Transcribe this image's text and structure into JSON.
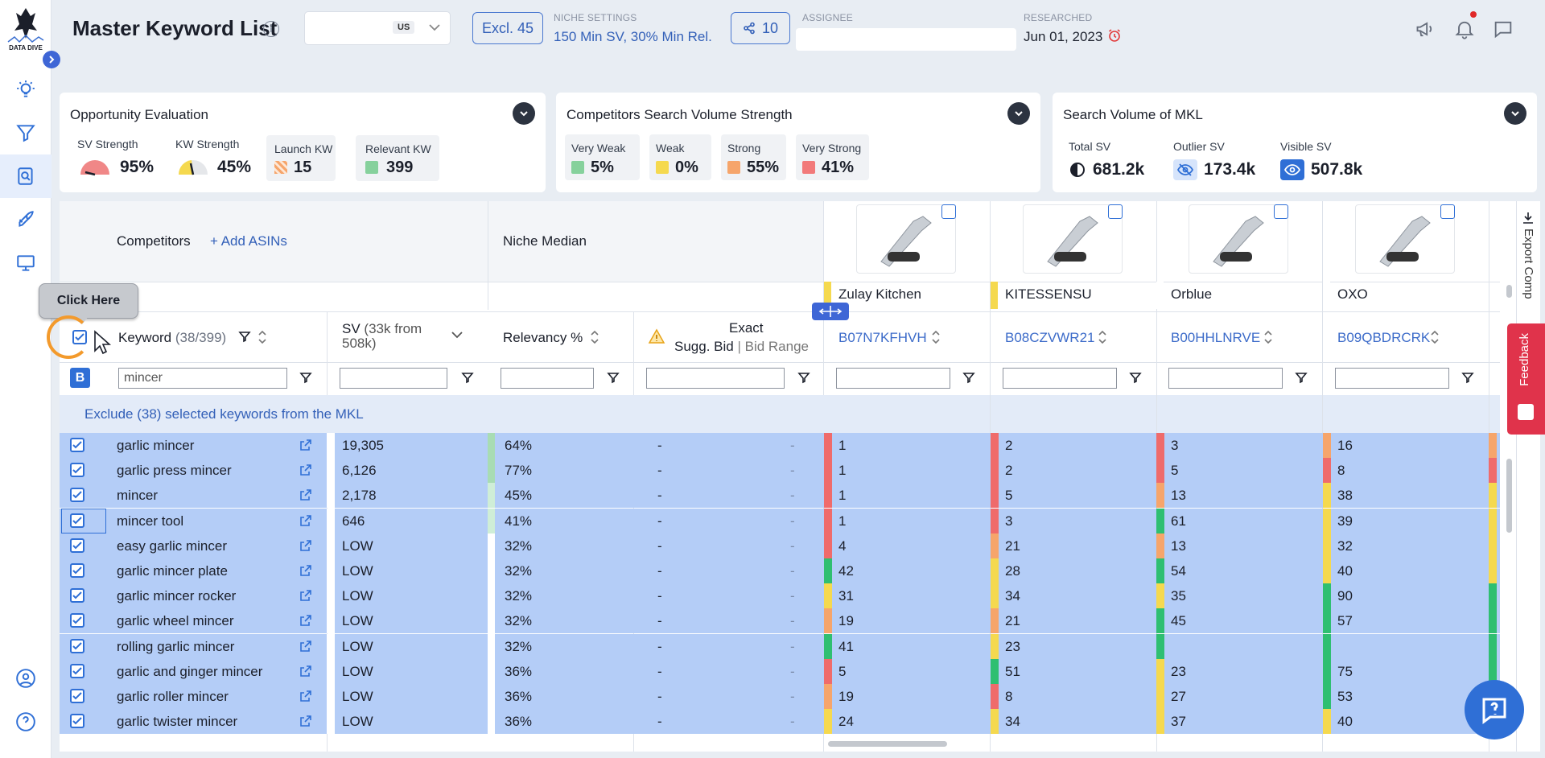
{
  "header": {
    "title": "Master Keyword List",
    "info": "i",
    "marketplace": "US",
    "excl_label": "Excl. 45",
    "niche_caption": "NICHE SETTINGS",
    "niche_value": "150 Min SV, 30% Min Rel.",
    "share_count": "10",
    "assignee_caption": "ASSIGNEE",
    "researched_caption": "RESEARCHED",
    "researched_date": "Jun 01, 2023"
  },
  "sidebar": {
    "logo_text": "DATA DIVE"
  },
  "opportunity": {
    "title": "Opportunity Evaluation",
    "sv_strength_label": "SV Strength",
    "sv_strength": "95%",
    "sv_strength_level": 0.95,
    "kw_strength_label": "KW Strength",
    "kw_strength": "45%",
    "kw_strength_level": 0.45,
    "launch_label": "Launch KW",
    "launch_value": "15",
    "relevant_label": "Relevant KW",
    "relevant_value": "399"
  },
  "competitors_strength": {
    "title": "Competitors Search Volume Strength",
    "items": [
      {
        "label": "Very Weak",
        "value": "5%",
        "color": "#86d19c"
      },
      {
        "label": "Weak",
        "value": "0%",
        "color": "#f5d94f"
      },
      {
        "label": "Strong",
        "value": "55%",
        "color": "#f6a56b"
      },
      {
        "label": "Very Strong",
        "value": "41%",
        "color": "#f27a7a"
      }
    ]
  },
  "search_volume": {
    "title": "Search Volume of MKL",
    "total_label": "Total SV",
    "total": "681.2k",
    "outlier_label": "Outlier SV",
    "outlier": "173.4k",
    "visible_label": "Visible SV",
    "visible": "507.8k"
  },
  "table": {
    "competitors_label": "Competitors",
    "add_asins": "+ Add ASINs",
    "niche_median": "Niche Median",
    "brand_row_label": "nd",
    "keyword_header": "Keyword",
    "keyword_count": "(38/399)",
    "sv_header": "SV",
    "sv_sub": "(33k from 508k)",
    "relevancy_header": "Relevancy %",
    "exact_header": "Exact",
    "sugg_bid": "Sugg. Bid",
    "bid_range": "Bid Range",
    "keyword_filter": "mincer",
    "b_badge": "B",
    "exclude_banner": "Exclude (38) selected keywords from the MKL",
    "competitors": [
      {
        "brand": "Zulay Kitchen",
        "asin": "B07N7KFHVH",
        "color": "#f5d94f"
      },
      {
        "brand": "KITESSENSU",
        "asin": "B08CZVWR21",
        "color": "#f5d94f"
      },
      {
        "brand": "Orblue",
        "asin": "B00HHLNRVE",
        "color": "#ffffff"
      },
      {
        "brand": "OXO",
        "asin": "B09QBDRCRK",
        "color": "#ffffff"
      }
    ],
    "rows": [
      {
        "kw": "garlic mincer",
        "sv": "19,305",
        "rel": "64%",
        "bid": "-",
        "range": "-",
        "r": [
          "1",
          "2",
          "3",
          "16"
        ],
        "c": [
          "#ef6b6b",
          "#ef6b6b",
          "#ef6b6b",
          "#f6a56b"
        ],
        "relc": "#a8dcb4"
      },
      {
        "kw": "garlic press mincer",
        "sv": "6,126",
        "rel": "77%",
        "bid": "-",
        "range": "-",
        "r": [
          "1",
          "2",
          "5",
          "8"
        ],
        "c": [
          "#ef6b6b",
          "#ef6b6b",
          "#ef6b6b",
          "#ef6b6b"
        ],
        "relc": "#a8dcb4"
      },
      {
        "kw": "mincer",
        "sv": "2,178",
        "rel": "45%",
        "bid": "-",
        "range": "-",
        "r": [
          "1",
          "5",
          "13",
          "38"
        ],
        "c": [
          "#ef6b6b",
          "#ef6b6b",
          "#f6a56b",
          "#f5d94f"
        ],
        "relc": "#cfeed7"
      },
      {
        "kw": "mincer tool",
        "sv": "646",
        "rel": "41%",
        "bid": "-",
        "range": "-",
        "r": [
          "1",
          "3",
          "61",
          "39"
        ],
        "c": [
          "#ef6b6b",
          "#ef6b6b",
          "#2fbf71",
          "#f5d94f"
        ],
        "relc": "#cfeed7"
      },
      {
        "kw": "easy garlic mincer",
        "sv": "LOW",
        "rel": "32%",
        "bid": "-",
        "range": "-",
        "r": [
          "4",
          "21",
          "13",
          "32"
        ],
        "c": [
          "#ef6b6b",
          "#f6a56b",
          "#f6a56b",
          "#f5d94f"
        ],
        "relc": "#ffffff"
      },
      {
        "kw": "garlic mincer plate",
        "sv": "LOW",
        "rel": "32%",
        "bid": "-",
        "range": "-",
        "r": [
          "42",
          "28",
          "54",
          "40"
        ],
        "c": [
          "#2fbf71",
          "#f5d94f",
          "#2fbf71",
          "#f5d94f"
        ],
        "relc": "#ffffff"
      },
      {
        "kw": "garlic mincer rocker",
        "sv": "LOW",
        "rel": "32%",
        "bid": "-",
        "range": "-",
        "r": [
          "31",
          "34",
          "35",
          "90"
        ],
        "c": [
          "#f5d94f",
          "#f5d94f",
          "#f5d94f",
          "#2fbf71"
        ],
        "relc": "#ffffff"
      },
      {
        "kw": "garlic wheel mincer",
        "sv": "LOW",
        "rel": "32%",
        "bid": "-",
        "range": "-",
        "r": [
          "19",
          "21",
          "45",
          "57"
        ],
        "c": [
          "#f6a56b",
          "#f6a56b",
          "#2fbf71",
          "#2fbf71"
        ],
        "relc": "#ffffff"
      },
      {
        "kw": "rolling garlic mincer",
        "sv": "LOW",
        "rel": "32%",
        "bid": "-",
        "range": "-",
        "r": [
          "41",
          "23",
          "",
          ""
        ],
        "c": [
          "#2fbf71",
          "#f5d94f",
          "#2fbf71",
          "#2fbf71"
        ],
        "relc": "#ffffff"
      },
      {
        "kw": "garlic and ginger mincer",
        "sv": "LOW",
        "rel": "36%",
        "bid": "-",
        "range": "-",
        "r": [
          "5",
          "51",
          "23",
          "75"
        ],
        "c": [
          "#ef6b6b",
          "#2fbf71",
          "#f5d94f",
          "#2fbf71"
        ],
        "relc": "#ffffff"
      },
      {
        "kw": "garlic roller mincer",
        "sv": "LOW",
        "rel": "36%",
        "bid": "-",
        "range": "-",
        "r": [
          "19",
          "8",
          "27",
          "53"
        ],
        "c": [
          "#f6a56b",
          "#ef6b6b",
          "#f5d94f",
          "#2fbf71"
        ],
        "relc": "#ffffff"
      },
      {
        "kw": "garlic twister mincer",
        "sv": "LOW",
        "rel": "36%",
        "bid": "-",
        "range": "-",
        "r": [
          "24",
          "34",
          "37",
          "40"
        ],
        "c": [
          "#f5d94f",
          "#f5d94f",
          "#f5d94f",
          "#f5d94f"
        ],
        "relc": "#ffffff"
      }
    ]
  },
  "tooltip": "Click Here",
  "export_label": "Export Comp",
  "feedback_label": "Feedback"
}
